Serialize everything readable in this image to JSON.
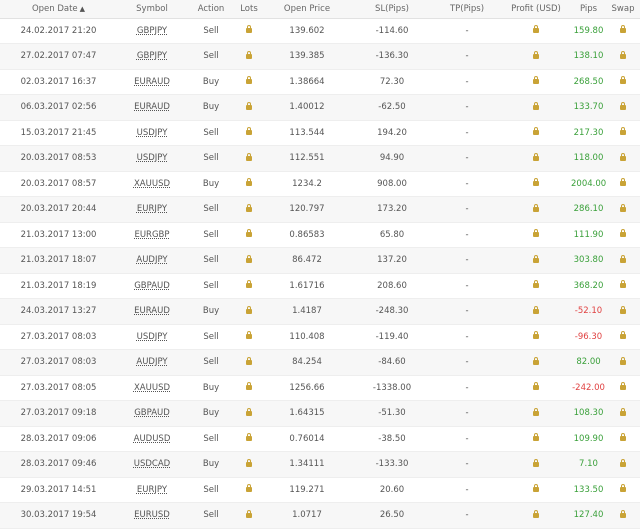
{
  "headers": {
    "open_date": "Open Date",
    "symbol": "Symbol",
    "action": "Action",
    "lots": "Lots",
    "open_price": "Open Price",
    "sl": "SL(Pips)",
    "tp": "TP(Pips)",
    "profit": "Profit (USD)",
    "pips": "Pips",
    "swap": "Swap"
  },
  "colors": {
    "positive": "#3aa03a",
    "negative": "#e04141",
    "lock": "#c9a336"
  },
  "lock_icon": "lock-icon",
  "rows": [
    {
      "open_date": "24.02.2017 21:20",
      "symbol": "GBPJPY",
      "action": "Sell",
      "open_price": "139.602",
      "sl": "-114.60",
      "tp": "-",
      "pips": "159.80",
      "sign": "pos"
    },
    {
      "open_date": "27.02.2017 07:47",
      "symbol": "GBPJPY",
      "action": "Sell",
      "open_price": "139.385",
      "sl": "-136.30",
      "tp": "-",
      "pips": "138.10",
      "sign": "pos"
    },
    {
      "open_date": "02.03.2017 16:37",
      "symbol": "EURAUD",
      "action": "Buy",
      "open_price": "1.38664",
      "sl": "72.30",
      "tp": "-",
      "pips": "268.50",
      "sign": "pos"
    },
    {
      "open_date": "06.03.2017 02:56",
      "symbol": "EURAUD",
      "action": "Buy",
      "open_price": "1.40012",
      "sl": "-62.50",
      "tp": "-",
      "pips": "133.70",
      "sign": "pos"
    },
    {
      "open_date": "15.03.2017 21:45",
      "symbol": "USDJPY",
      "action": "Sell",
      "open_price": "113.544",
      "sl": "194.20",
      "tp": "-",
      "pips": "217.30",
      "sign": "pos"
    },
    {
      "open_date": "20.03.2017 08:53",
      "symbol": "USDJPY",
      "action": "Sell",
      "open_price": "112.551",
      "sl": "94.90",
      "tp": "-",
      "pips": "118.00",
      "sign": "pos"
    },
    {
      "open_date": "20.03.2017 08:57",
      "symbol": "XAUUSD",
      "action": "Buy",
      "open_price": "1234.2",
      "sl": "908.00",
      "tp": "-",
      "pips": "2004.00",
      "sign": "pos"
    },
    {
      "open_date": "20.03.2017 20:44",
      "symbol": "EURJPY",
      "action": "Sell",
      "open_price": "120.797",
      "sl": "173.20",
      "tp": "-",
      "pips": "286.10",
      "sign": "pos"
    },
    {
      "open_date": "21.03.2017 13:00",
      "symbol": "EURGBP",
      "action": "Sell",
      "open_price": "0.86583",
      "sl": "65.80",
      "tp": "-",
      "pips": "111.90",
      "sign": "pos"
    },
    {
      "open_date": "21.03.2017 18:07",
      "symbol": "AUDJPY",
      "action": "Sell",
      "open_price": "86.472",
      "sl": "137.20",
      "tp": "-",
      "pips": "303.80",
      "sign": "pos"
    },
    {
      "open_date": "21.03.2017 18:19",
      "symbol": "GBPAUD",
      "action": "Sell",
      "open_price": "1.61716",
      "sl": "208.60",
      "tp": "-",
      "pips": "368.20",
      "sign": "pos"
    },
    {
      "open_date": "24.03.2017 13:27",
      "symbol": "EURAUD",
      "action": "Buy",
      "open_price": "1.4187",
      "sl": "-248.30",
      "tp": "-",
      "pips": "-52.10",
      "sign": "neg"
    },
    {
      "open_date": "27.03.2017 08:03",
      "symbol": "USDJPY",
      "action": "Sell",
      "open_price": "110.408",
      "sl": "-119.40",
      "tp": "-",
      "pips": "-96.30",
      "sign": "neg"
    },
    {
      "open_date": "27.03.2017 08:03",
      "symbol": "AUDJPY",
      "action": "Sell",
      "open_price": "84.254",
      "sl": "-84.60",
      "tp": "-",
      "pips": "82.00",
      "sign": "pos"
    },
    {
      "open_date": "27.03.2017 08:05",
      "symbol": "XAUUSD",
      "action": "Buy",
      "open_price": "1256.66",
      "sl": "-1338.00",
      "tp": "-",
      "pips": "-242.00",
      "sign": "neg"
    },
    {
      "open_date": "27.03.2017 09:18",
      "symbol": "GBPAUD",
      "action": "Buy",
      "open_price": "1.64315",
      "sl": "-51.30",
      "tp": "-",
      "pips": "108.30",
      "sign": "pos"
    },
    {
      "open_date": "28.03.2017 09:06",
      "symbol": "AUDUSD",
      "action": "Sell",
      "open_price": "0.76014",
      "sl": "-38.50",
      "tp": "-",
      "pips": "109.90",
      "sign": "pos"
    },
    {
      "open_date": "28.03.2017 09:46",
      "symbol": "USDCAD",
      "action": "Buy",
      "open_price": "1.34111",
      "sl": "-133.30",
      "tp": "-",
      "pips": "7.10",
      "sign": "pos"
    },
    {
      "open_date": "29.03.2017 14:51",
      "symbol": "EURJPY",
      "action": "Sell",
      "open_price": "119.271",
      "sl": "20.60",
      "tp": "-",
      "pips": "133.50",
      "sign": "pos"
    },
    {
      "open_date": "30.03.2017 19:54",
      "symbol": "EURUSD",
      "action": "Sell",
      "open_price": "1.0717",
      "sl": "26.50",
      "tp": "-",
      "pips": "127.40",
      "sign": "pos"
    }
  ]
}
